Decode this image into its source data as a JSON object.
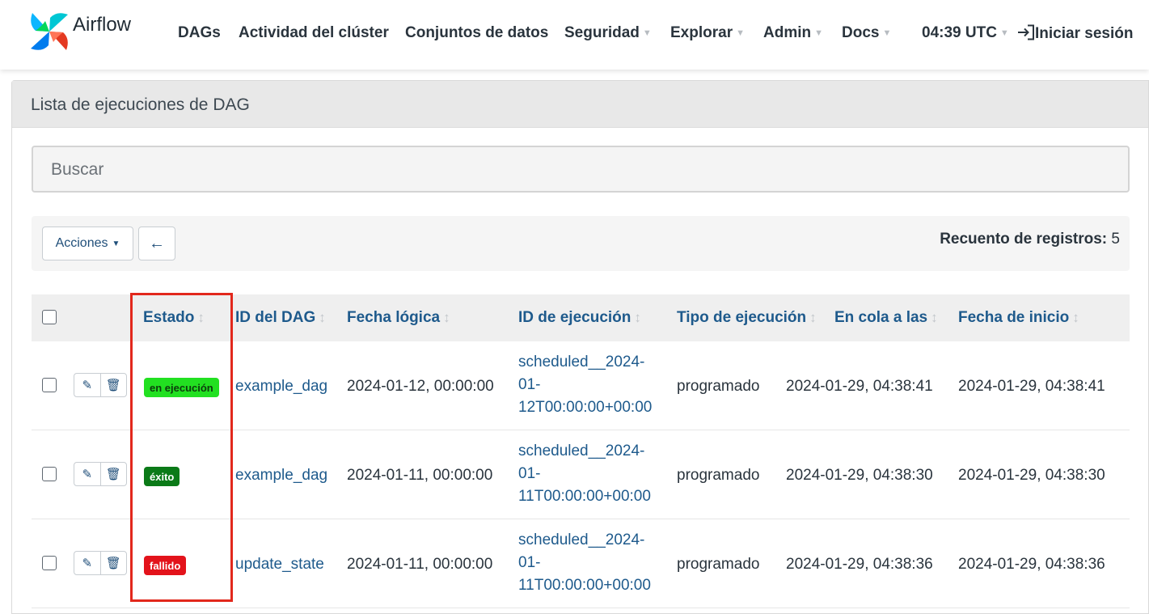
{
  "navbar": {
    "brand": "Airflow",
    "items": [
      "DAGs",
      "Actividad del clúster",
      "Conjuntos de datos",
      "Seguridad",
      "Explorar",
      "Admin",
      "Docs"
    ],
    "time": "04:39 UTC",
    "login": "Iniciar sesión",
    "icons": {
      "brand": "airflow-pinwheel-logo",
      "login": "sign-in-icon",
      "caret": "caret-down-icon"
    }
  },
  "panel": {
    "title": "Lista de ejecuciones de DAG"
  },
  "search": {
    "placeholder": "Buscar"
  },
  "toolbar": {
    "actions_label": "Acciones",
    "back_glyph": "←",
    "record_count_label": "Recuento de registros:",
    "record_count_value": "5"
  },
  "table": {
    "columns": [
      "Estado",
      "ID del DAG",
      "Fecha lógica",
      "ID de ejecución",
      "Tipo de ejecución",
      "En cola a las",
      "Fecha de inicio"
    ],
    "rows": [
      {
        "state": "en ejecución",
        "state_color": "#22e021",
        "state_text_color": "#0d3b0d",
        "dag_id": "example_dag",
        "logical_date": "2024-01-12, 00:00:00",
        "run_id_lines": [
          "scheduled__2024-",
          "01-",
          "12T00:00:00+00:00"
        ],
        "run_type": "programado",
        "queued_at": "2024-01-29, 04:38:41",
        "start_date": "2024-01-29, 04:38:41"
      },
      {
        "state": "éxito",
        "state_color": "#0b7a18",
        "state_text_color": "#ffffff",
        "dag_id": "example_dag",
        "logical_date": "2024-01-11, 00:00:00",
        "run_id_lines": [
          "scheduled__2024-",
          "01-",
          "11T00:00:00+00:00"
        ],
        "run_type": "programado",
        "queued_at": "2024-01-29, 04:38:30",
        "start_date": "2024-01-29, 04:38:30"
      },
      {
        "state": "fallido",
        "state_color": "#e3131b",
        "state_text_color": "#ffffff",
        "dag_id": "update_state",
        "logical_date": "2024-01-11, 00:00:00",
        "run_id_lines": [
          "scheduled__2024-",
          "01-",
          "11T00:00:00+00:00"
        ],
        "run_type": "programado",
        "queued_at": "2024-01-29, 04:38:36",
        "start_date": "2024-01-29, 04:38:36"
      }
    ]
  },
  "colors": {
    "highlight": "#e2281c",
    "link": "#1e5a8c"
  }
}
